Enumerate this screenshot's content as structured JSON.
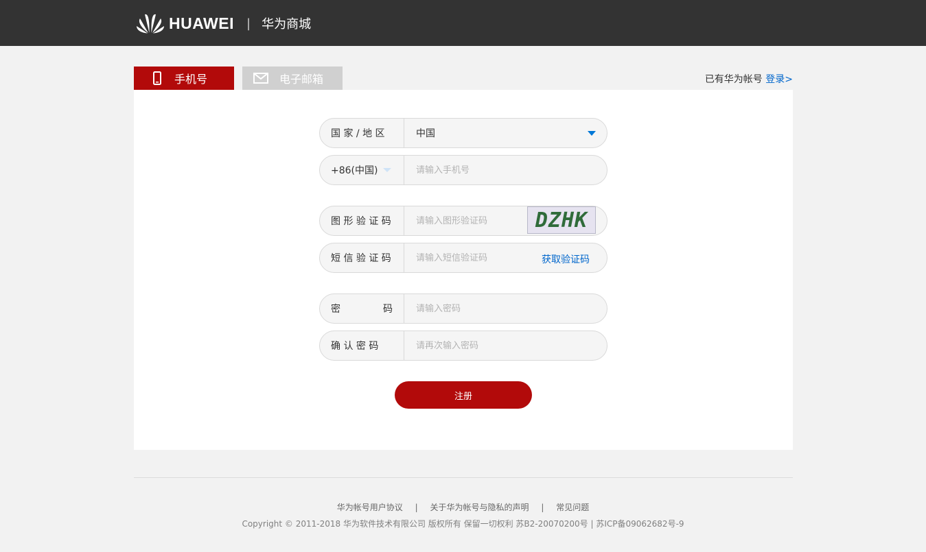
{
  "header": {
    "brand": "HUAWEI",
    "separator": "|",
    "shop_name": "华为商城"
  },
  "tabs": [
    {
      "label": "手机号",
      "icon": "phone-icon",
      "active": true
    },
    {
      "label": "电子邮箱",
      "icon": "mail-icon",
      "active": false
    }
  ],
  "login_prompt": {
    "text": "已有华为帐号",
    "link": "登录>"
  },
  "form": {
    "country": {
      "label": "国 家 / 地 区",
      "value": "中国"
    },
    "phone": {
      "code": "+86(中国)",
      "placeholder": "请输入手机号"
    },
    "captcha": {
      "label": "图 形 验 证 码",
      "placeholder": "请输入图形验证码",
      "image_text": "DZHK"
    },
    "sms": {
      "label": "短 信 验 证 码",
      "placeholder": "请输入短信验证码",
      "action": "获取验证码"
    },
    "password": {
      "label_left": "密",
      "label_right": "码",
      "placeholder": "请输入密码"
    },
    "confirm": {
      "label": "确 认 密 码",
      "placeholder": "请再次输入密码"
    },
    "submit": "注册"
  },
  "footer": {
    "links": [
      "华为帐号用户协议",
      "关于华为帐号与隐私的声明",
      "常见问题"
    ],
    "separator": "|",
    "copyright": "Copyright © 2011-2018  华为软件技术有限公司  版权所有  保留一切权利  苏B2-20070200号 | 苏ICP备09062682号-9"
  },
  "colors": {
    "header_bg": "#333333",
    "accent_red": "#b20a0a",
    "link_blue": "#0066cc",
    "inactive_tab": "#d0d0d0"
  }
}
